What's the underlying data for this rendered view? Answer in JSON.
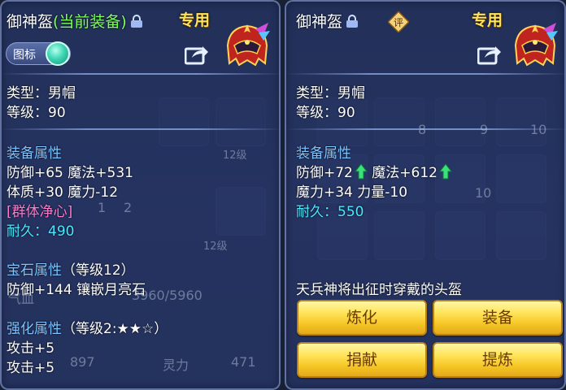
{
  "left_panel": {
    "title_name": "御神盔",
    "title_equipped": "(当前装备)",
    "exclusive_label": "专用",
    "icon_toggle_label": "图标",
    "type_line": "类型：男帽",
    "level_line": "等级：90",
    "equip_attr_header": "装备属性",
    "attr_line_1": "防御+65 魔法+531",
    "attr_line_2": "体质+30 魔力-12",
    "special_skill": "[群体净心]",
    "durability_label": "耐久：",
    "durability_value": "490",
    "gem_attr_header": "宝石属性",
    "gem_level": "（等级12）",
    "gem_line": "防御+144 镶嵌月亮石",
    "enhance_attr_header": "强化属性",
    "enhance_level": "（等级2:★★☆）",
    "enhance_line_1": "攻击+5",
    "enhance_line_2": "攻击+5"
  },
  "right_panel": {
    "title_name": "御神盔",
    "exclusive_label": "专用",
    "appraise_label": "评",
    "type_line": "类型：男帽",
    "level_line": "等级：90",
    "equip_attr_header": "装备属性",
    "defense": "防御+72",
    "magic": "魔法+612",
    "attr_line_2": "魔力+34 力量-10",
    "durability_label": "耐久：",
    "durability_value": "550",
    "description": "天兵神将出征时穿戴的头盔",
    "buttons": {
      "refine": "炼化",
      "equip": "装备",
      "donate": "捐献",
      "extract": "提炼"
    }
  },
  "background": {
    "slot_numbers": [
      "8",
      "9",
      "10",
      "10",
      "12级",
      "12级",
      "2",
      "1"
    ],
    "stats": [
      "气血",
      "3960/5960",
      "897",
      "灵力",
      "471"
    ]
  },
  "colors": {
    "equipped_green": "#7dff5a",
    "exclusive_gold": "#ffe35a",
    "header_blue": "#7ec3ff",
    "durability_cyan": "#4fe7ff",
    "special_pink": "#ff7ad1",
    "button_gold": "#f5c524"
  }
}
